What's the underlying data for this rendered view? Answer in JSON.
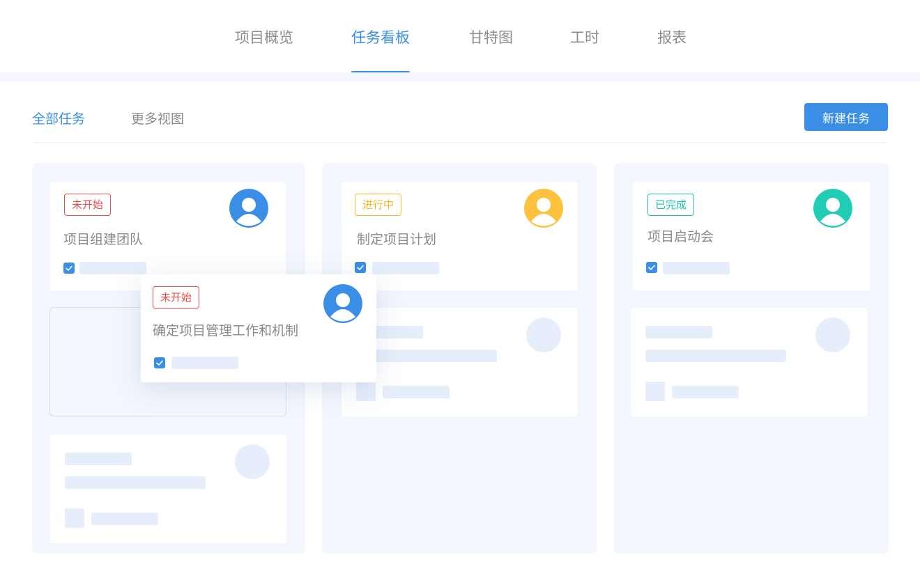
{
  "top_tabs": [
    {
      "label": "项目概览",
      "active": false
    },
    {
      "label": "任务看板",
      "active": true
    },
    {
      "label": "甘特图",
      "active": false
    },
    {
      "label": "工时",
      "active": false
    },
    {
      "label": "报表",
      "active": false
    }
  ],
  "sub_tabs": [
    {
      "label": "全部任务",
      "active": true
    },
    {
      "label": "更多视图",
      "active": false
    }
  ],
  "toolbar": {
    "new_task_label": "新建任务"
  },
  "colors": {
    "accent": "#3a8ee6",
    "not_started": "#e84b4b",
    "in_progress": "#f7b731",
    "done": "#1ec3aa",
    "avatar_blue": "#3a8ee6",
    "avatar_yellow": "#fdc23e",
    "avatar_teal": "#22cdb5"
  },
  "columns": [
    {
      "cards": [
        {
          "status": "未开始",
          "title": "项目组建团队",
          "avatar": "user-avatar-icon"
        }
      ]
    },
    {
      "cards": [
        {
          "status": "进行中",
          "title": "制定项目计划",
          "avatar": "user-avatar-icon"
        }
      ]
    },
    {
      "cards": [
        {
          "status": "已完成",
          "title": "项目启动会",
          "avatar": "user-avatar-icon"
        }
      ]
    }
  ],
  "dragging_card": {
    "status": "未开始",
    "title": "确定项目管理工作和机制",
    "avatar": "user-avatar-icon"
  }
}
